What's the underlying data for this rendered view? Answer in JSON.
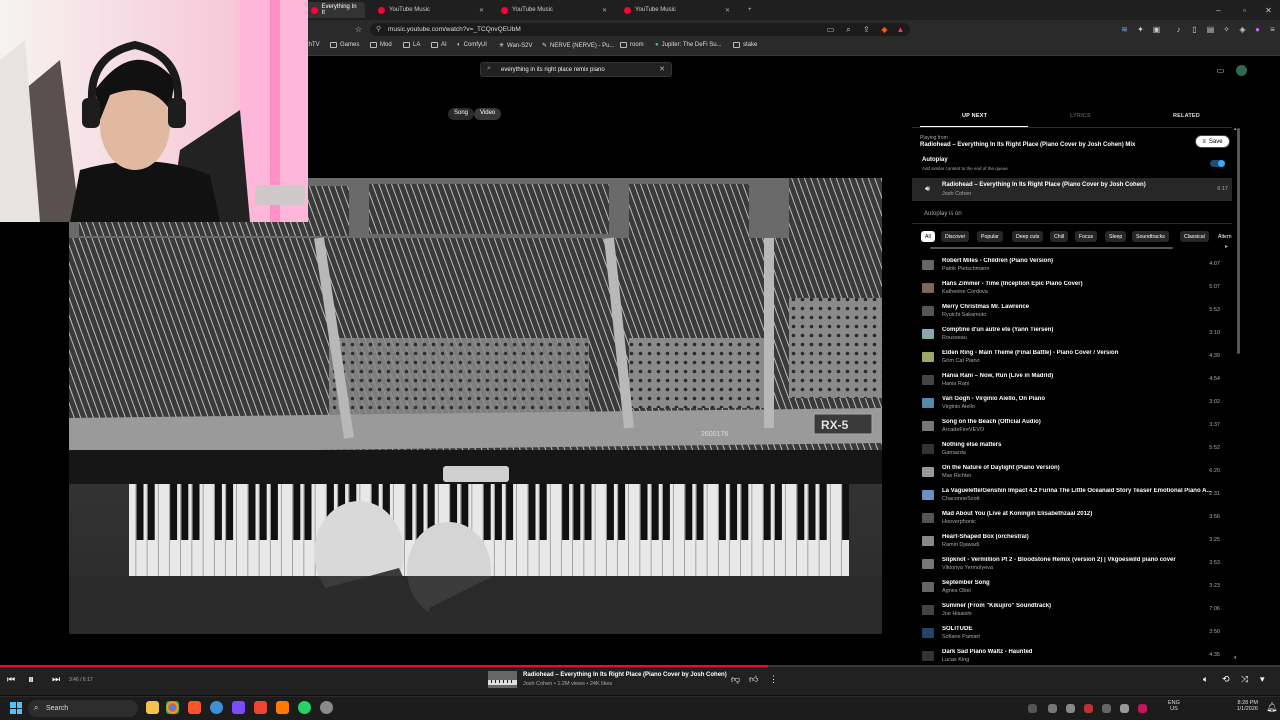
{
  "tabs": [
    {
      "label": "Everything In It"
    },
    {
      "label": "YouTube Music"
    },
    {
      "label": "YouTube Music"
    },
    {
      "label": "YouTube Music"
    }
  ],
  "address": {
    "url": "music.youtube.com/watch?v=_TCQnvQEUbM"
  },
  "bookmarks": [
    {
      "label": "thTV"
    },
    {
      "label": "Games"
    },
    {
      "label": "Mod"
    },
    {
      "label": "LA"
    },
    {
      "label": "AI"
    },
    {
      "label": "ComfyUI"
    },
    {
      "label": "Wan-S2V"
    },
    {
      "label": "NERVE (NERVE) - Pu..."
    },
    {
      "label": "room"
    },
    {
      "label": "Jupiter: The DeFi Su..."
    },
    {
      "label": "stake"
    }
  ],
  "search": {
    "query": "everything in its right place remix piano"
  },
  "view_toggle": {
    "song": "Song",
    "video": "Video",
    "selected": "Video"
  },
  "video": {
    "piano_label": "RX-5",
    "serial": "2600176"
  },
  "panel": {
    "tabs": {
      "up_next": "UP NEXT",
      "lyrics": "LYRICS",
      "related": "RELATED"
    },
    "playing_from_label": "Playing from",
    "playing_from": "Radiohead – Everything In Its Right Place (Piano Cover by Josh Cohen) Mix",
    "save": "Save",
    "autoplay": {
      "title": "Autoplay",
      "desc": "Add similar content to the end of the queue",
      "on": true
    },
    "now_playing": {
      "title": "Radiohead – Everything In Its Right Place (Piano Cover by Josh Cohen)",
      "artist": "Josh Cohen",
      "duration": "6:17"
    },
    "autoplay_on": "Autoplay is on",
    "chips": [
      "All",
      "Discover",
      "Popular",
      "Deep cuts",
      "Chill",
      "Focus",
      "Sleep",
      "Soundtracks",
      "Classical",
      "Altern"
    ],
    "queue": [
      {
        "title": "Robert Miles - Children (Piano Version)",
        "artist": "Patrik Pietschmann",
        "duration": "4:07"
      },
      {
        "title": "Hans Zimmer - Time (Inception Epic Piano Cover)",
        "artist": "Katherine Cordova",
        "duration": "5:07"
      },
      {
        "title": "Merry Christmas Mr. Lawrence",
        "artist": "Ryuichi Sakamoto",
        "duration": "5:53"
      },
      {
        "title": "Comptine d'un autre ete (Yann Tiersen)",
        "artist": "Rousseau",
        "duration": "3:10"
      },
      {
        "title": "Elden Ring - Main Theme (Final Battle) - Piano Cover / Version",
        "artist": "Grim Cat Piano",
        "duration": "4:39"
      },
      {
        "title": "Hania Rani – Now, Run (Live in Madrid)",
        "artist": "Hania Rani",
        "duration": "4:54"
      },
      {
        "title": "Van Gogh - Virginio Aiello, On Piano",
        "artist": "Virginio Aiello",
        "duration": "3:02"
      },
      {
        "title": "Song on the Beach (Official Audio)",
        "artist": "ArcadeFireVEVO",
        "duration": "3:37"
      },
      {
        "title": "Nothing else matters",
        "artist": "Gamazda",
        "duration": "5:52"
      },
      {
        "title": "On the Nature of Daylight (Piano Version)",
        "artist": "Max Richter",
        "duration": "6:20"
      },
      {
        "title": "La Vaguelette/Genshin Impact 4.2 Furina The Little Oceanaid Story Teaser Emotional Piano A...",
        "artist": "ChaconneScott",
        "duration": "2:31"
      },
      {
        "title": "Mad About You (Live at Koningin Elisabethzaal 2012)",
        "artist": "Hooverphonic",
        "duration": "3:56"
      },
      {
        "title": "Heart-Shaped Box (orchestral)",
        "artist": "Ramin Djawadi",
        "duration": "3:25"
      },
      {
        "title": "Slipknot - Vermillion Pt 2 - Bloodstone Remix (version 2) | Vkgoeswild piano cover",
        "artist": "Viktoriya Yermolyeva",
        "duration": "3:53"
      },
      {
        "title": "September Song",
        "artist": "Agnes Obel",
        "duration": "3:23"
      },
      {
        "title": "Summer (From \"Kikujiro\" Soundtrack)",
        "artist": "Joe Hisaishi",
        "duration": "7:06"
      },
      {
        "title": "SOLITUDE",
        "artist": "Sofiane Pamart",
        "duration": "3:50"
      },
      {
        "title": "Dark Sad Piano Waltz - Haunted",
        "artist": "Lucas King",
        "duration": "4:35"
      }
    ]
  },
  "player": {
    "time": "3:46 / 6:17",
    "progress": 0.6,
    "title": "Radiohead – Everything In Its Right Place (Piano Cover by Josh Cohen)",
    "meta": "Josh Cohen • 1.2M views • 24K likes"
  },
  "taskbar": {
    "search": "Search",
    "lang": "ENG",
    "region": "US",
    "time": "8:28 PM",
    "date": "1/1/2026"
  },
  "colors": {
    "accent": "#ff0033",
    "toggle": "#3ea6ff"
  }
}
